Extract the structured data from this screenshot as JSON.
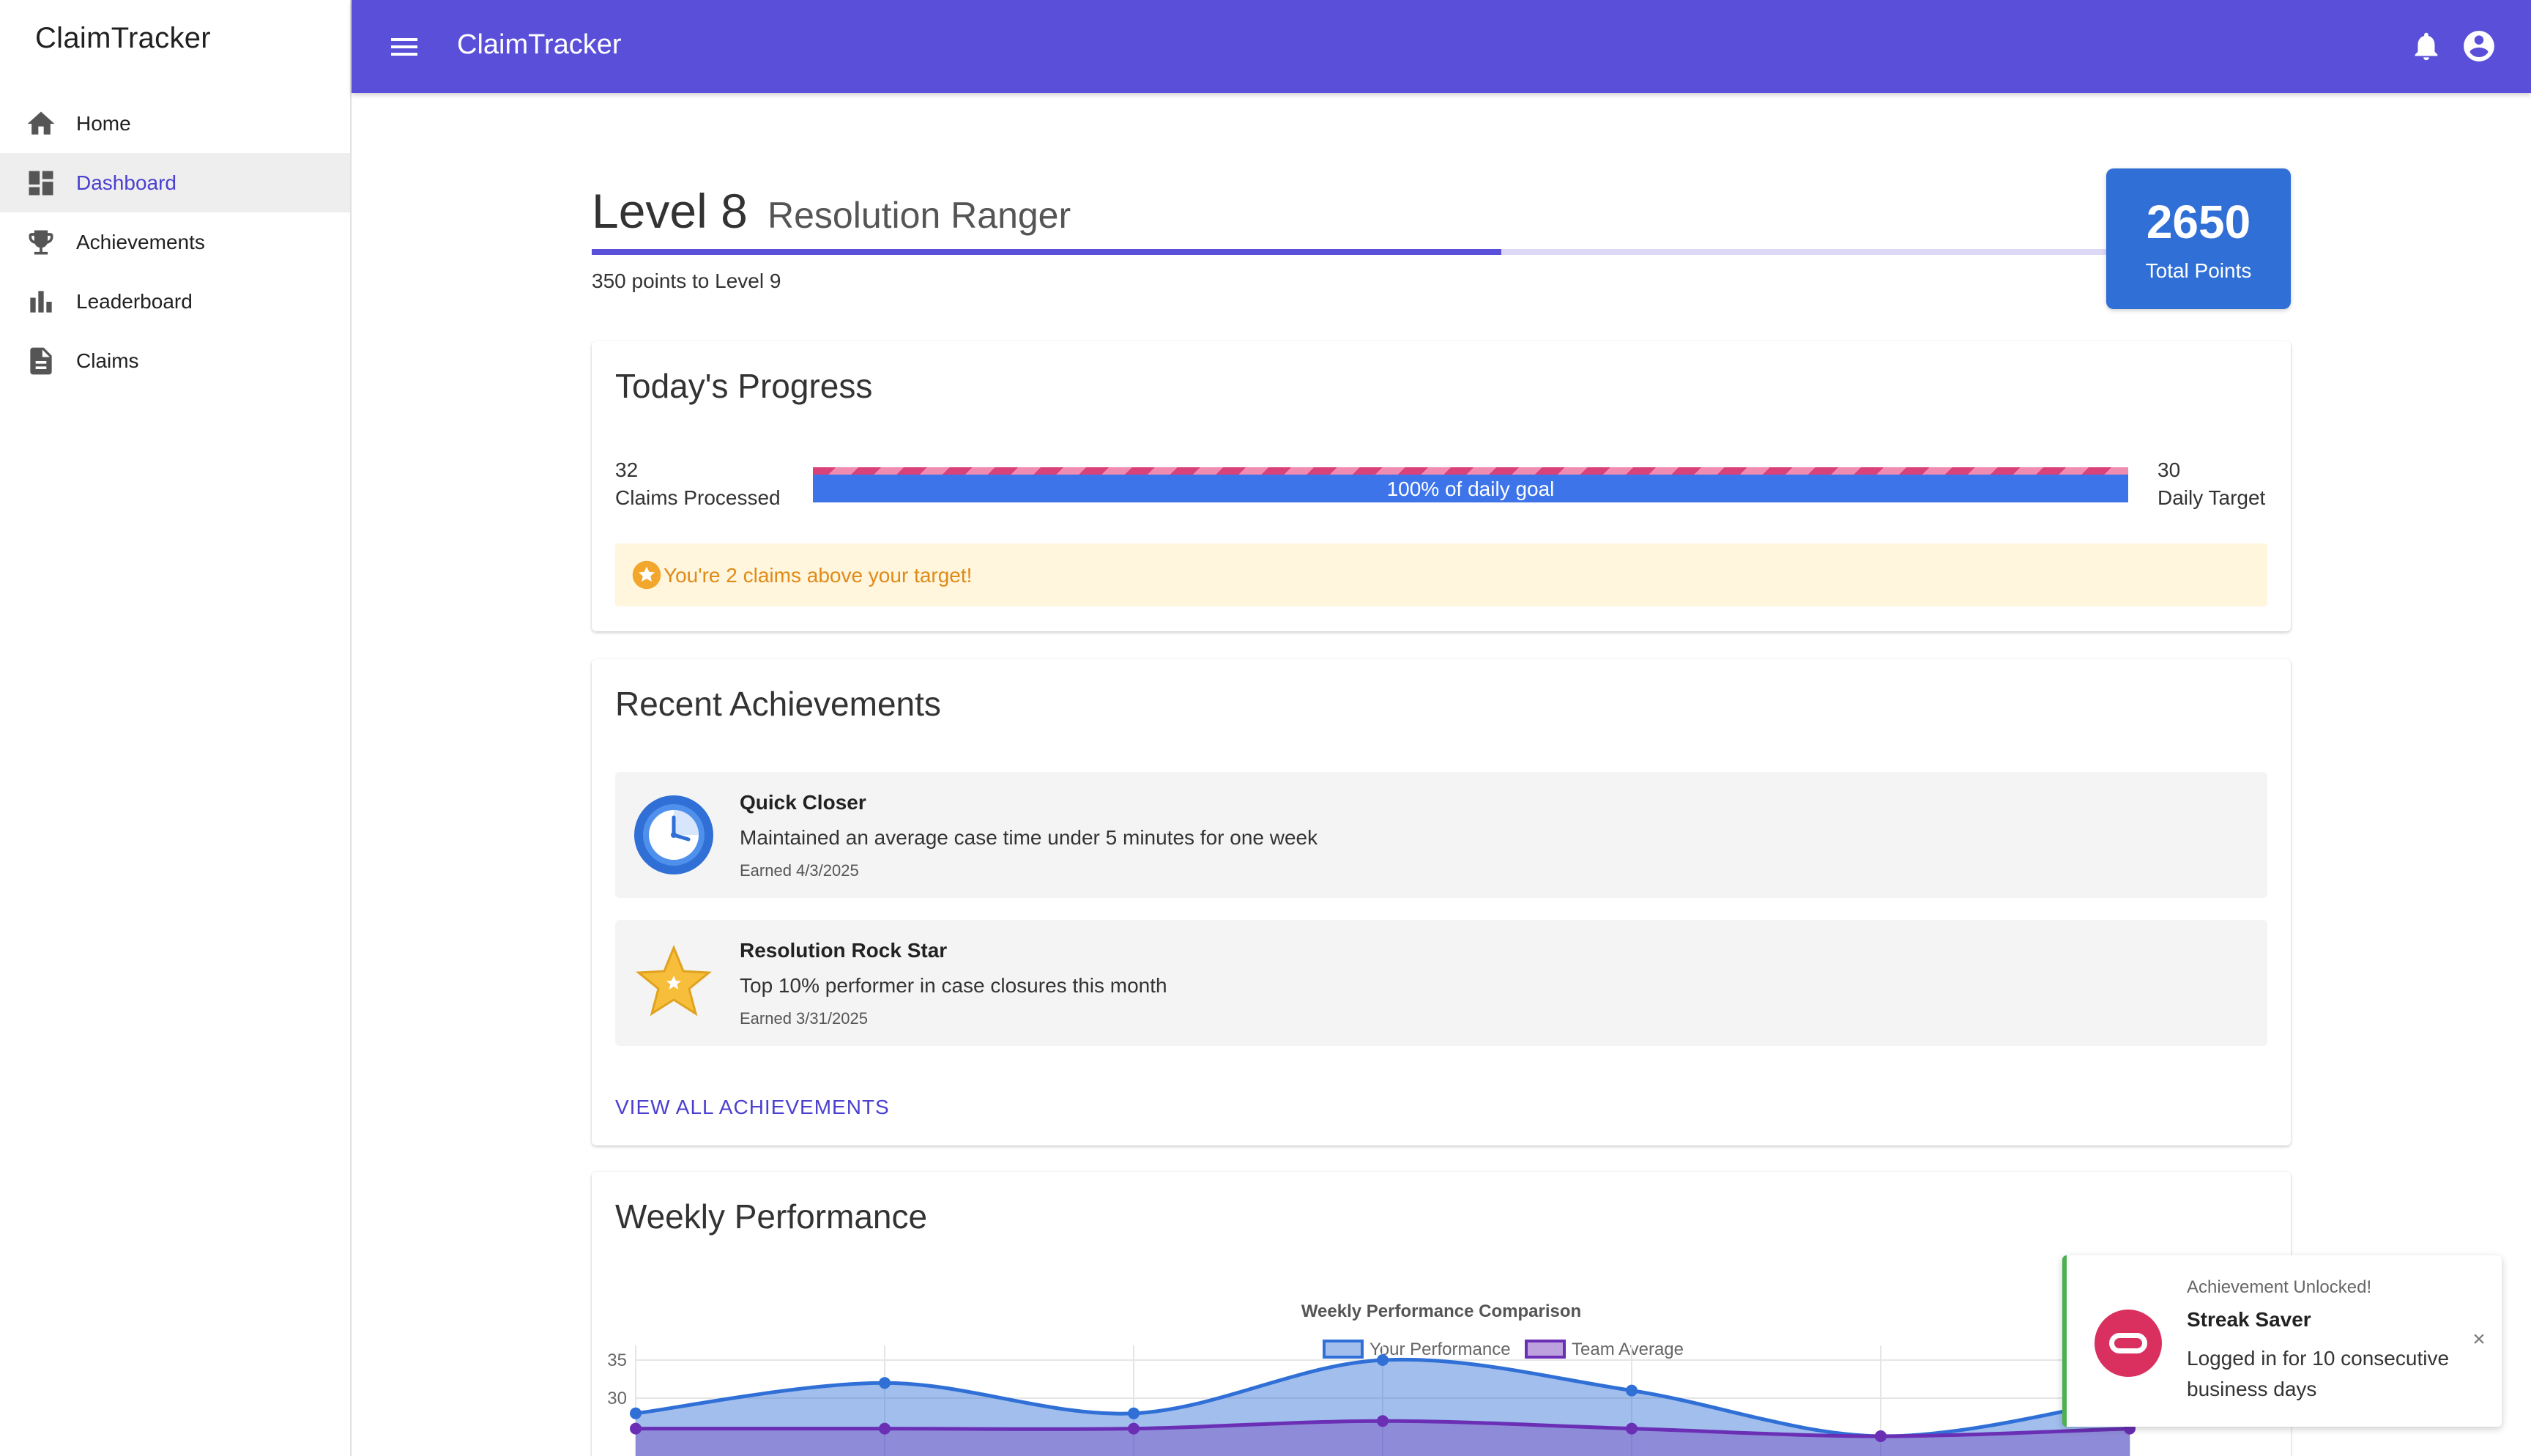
{
  "sidebar": {
    "brand": "ClaimTracker",
    "items": [
      {
        "label": "Home",
        "icon": "home-icon"
      },
      {
        "label": "Dashboard",
        "icon": "dashboard-icon",
        "active": true
      },
      {
        "label": "Achievements",
        "icon": "trophy-icon"
      },
      {
        "label": "Leaderboard",
        "icon": "bar-chart-icon"
      },
      {
        "label": "Claims",
        "icon": "document-icon"
      }
    ]
  },
  "topbar": {
    "title": "ClaimTracker",
    "icons": [
      "menu-icon",
      "bell-icon",
      "account-circle-icon"
    ]
  },
  "level": {
    "title": "Level 8",
    "name": "Resolution Ranger",
    "progress_fraction": 0.6,
    "points_note": "350 points to Level 9",
    "total_points": "2650",
    "total_points_label": "Total Points"
  },
  "today": {
    "title": "Today's Progress",
    "claims_processed": "32",
    "claims_processed_label": "Claims Processed",
    "daily_target": "30",
    "daily_target_label": "Daily Target",
    "goal_percent": 100,
    "goal_text": "100% of daily goal",
    "notice": "You're 2 claims above your target!"
  },
  "achievements": {
    "title": "Recent Achievements",
    "items": [
      {
        "name": "Quick Closer",
        "description": "Maintained an average case time under 5 minutes for one week",
        "earned": "Earned 4/3/2025",
        "icon": "clock-icon"
      },
      {
        "name": "Resolution Rock Star",
        "description": "Top 10% performer in case closures this month",
        "earned": "Earned 3/31/2025",
        "icon": "star-icon"
      }
    ],
    "view_all": "VIEW ALL ACHIEVEMENTS"
  },
  "weekly": {
    "title": "Weekly Performance"
  },
  "chart_data": {
    "type": "area",
    "title": "Weekly Performance Comparison",
    "series": [
      {
        "name": "Your Performance",
        "values": [
          28,
          32,
          28,
          35,
          31,
          25,
          30
        ],
        "color": "#2f6fd6"
      },
      {
        "name": "Team Average",
        "values": [
          26,
          26,
          26,
          27,
          26,
          25,
          26
        ],
        "color": "#6a2fb5"
      }
    ],
    "yticks": [
      35,
      30
    ],
    "ylim": [
      20,
      35
    ],
    "legend": "top",
    "grid": true
  },
  "toast": {
    "kicker": "Achievement Unlocked!",
    "title": "Streak Saver",
    "message": "Logged in for 10 consecutive business days",
    "close": "×",
    "icon": "streak-badge-icon",
    "accent": "#4caf50"
  },
  "colors": {
    "primary": "#594fd9",
    "points_box": "#2f6fd6",
    "goal_fill": "#3d74ea",
    "notice_bg": "#fff6dd",
    "notice_text": "#e08a17"
  }
}
